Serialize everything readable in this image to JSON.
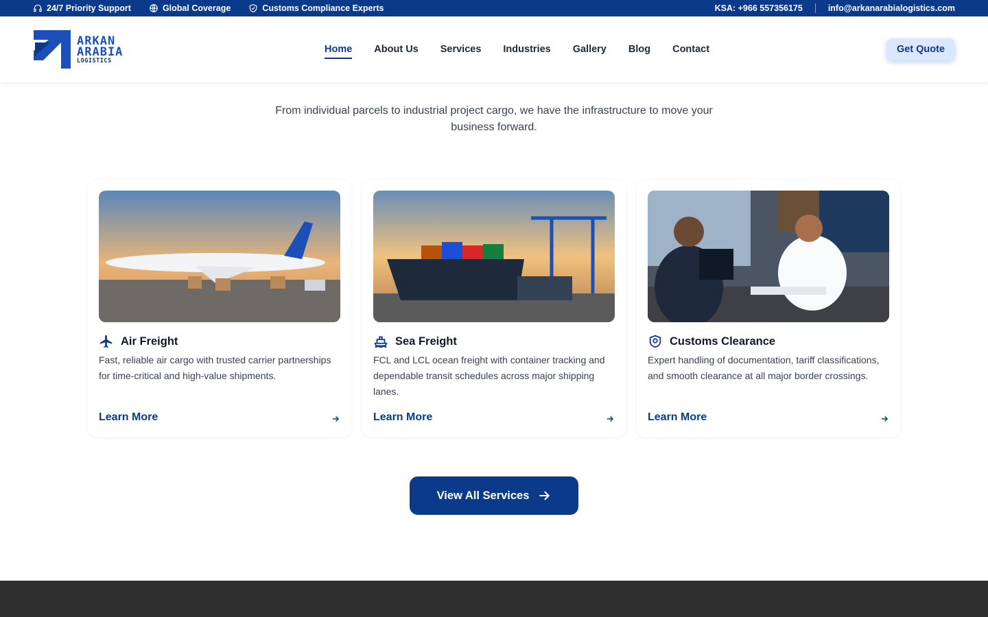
{
  "topbar": {
    "support": "24/7 Priority Support",
    "coverage": "Global Coverage",
    "compliance": "Customs Compliance Experts",
    "phone": "KSA: +966 557356175",
    "email": "info@arkanarabialogistics.com"
  },
  "brand": {
    "line1": "ARKAN",
    "line2": "ARABIA",
    "line3": "LOGISTICS",
    "color": "#1d4fb8"
  },
  "nav": {
    "items": [
      "Home",
      "About Us",
      "Services",
      "Industries",
      "Gallery",
      "Blog",
      "Contact"
    ],
    "active": "Home"
  },
  "header": {
    "quote_label": "Get Quote"
  },
  "section": {
    "intro": "From individual parcels to industrial project cargo, we have the infrastructure to move your business forward."
  },
  "cards": [
    {
      "title": "Air Freight",
      "icon": "airplane-icon",
      "description": "Fast, reliable air cargo with trusted carrier partnerships for time-critical and high-value shipments.",
      "link": "Learn More"
    },
    {
      "title": "Sea Freight",
      "icon": "ship-icon",
      "description": "FCL and LCL ocean freight with container tracking and dependable transit schedules across major shipping lanes.",
      "link": "Learn More"
    },
    {
      "title": "Customs Clearance",
      "icon": "shield-check-icon",
      "description": "Expert handling of documentation, tariff classifications, and smooth clearance at all major border crossings.",
      "link": "Learn More"
    }
  ],
  "cta": {
    "view_all": "View All Services"
  },
  "colors": {
    "primary": "#0b3a8a",
    "quote_bg": "#dbe7ff",
    "footer": "#2f2f2f"
  }
}
